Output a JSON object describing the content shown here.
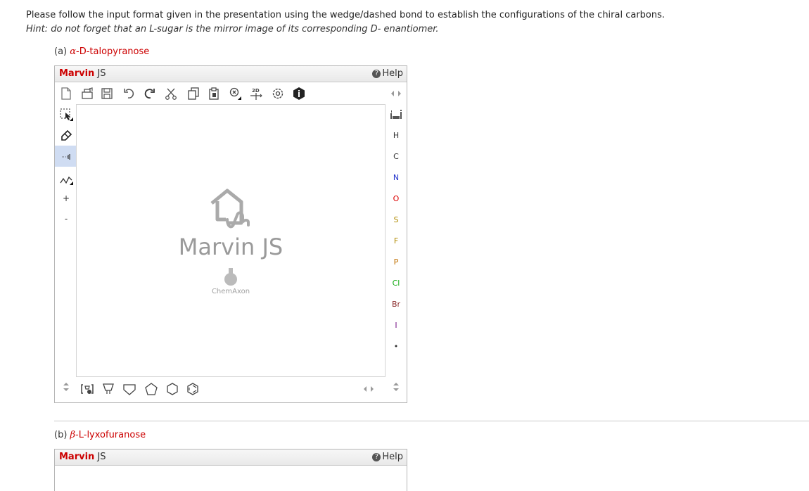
{
  "instructions": {
    "line1": "Please follow the input format given in the presentation using the wedge/dashed bond to establish the configurations of the chiral carbons.",
    "hint": "Hint: do not forget that an L-sugar is the mirror image of its corresponding D- enantiomer."
  },
  "question_a": {
    "prefix": "(a) ",
    "greek": "α",
    "name": "-D-talopyranose"
  },
  "question_b": {
    "prefix": "(b) ",
    "greek": "β",
    "name": "-L-lyxofuranose"
  },
  "editor": {
    "brand": "Marvin",
    "brand_suffix": " JS",
    "help_label": "Help",
    "help_icon": "?",
    "top_toolbar": [
      "new-document-icon",
      "open-icon",
      "save-icon",
      "undo-icon",
      "redo-icon",
      "cut-icon",
      "copy-icon",
      "paste-icon",
      "zoom-reset-icon",
      "clean-2d-icon",
      "settings-icon",
      "about-icon"
    ],
    "clean_label": "2D",
    "left_toolbar": [
      "select-icon",
      "erase-icon",
      "bond-icon",
      "chain-icon",
      "increase-charge",
      "decrease-charge"
    ],
    "charge_plus": "+",
    "charge_minus": "-",
    "logo_text": "Marvin JS",
    "logo_company": "ChemAxon",
    "elements": [
      {
        "symbol": "H",
        "color": "#333333"
      },
      {
        "symbol": "C",
        "color": "#333333"
      },
      {
        "symbol": "N",
        "color": "#2233cc"
      },
      {
        "symbol": "O",
        "color": "#dd0000"
      },
      {
        "symbol": "S",
        "color": "#b08a00"
      },
      {
        "symbol": "F",
        "color": "#b08a00"
      },
      {
        "symbol": "P",
        "color": "#c07000"
      },
      {
        "symbol": "Cl",
        "color": "#11aa11"
      },
      {
        "symbol": "Br",
        "color": "#8a2a2a"
      },
      {
        "symbol": "I",
        "color": "#7a1a8a"
      },
      {
        "symbol": "•",
        "color": "#333333"
      }
    ],
    "bottom_shapes": [
      "template-icon",
      "cyclopropane-icon",
      "cyclobutane-icon",
      "cyclopentane-icon",
      "cyclohexane-icon",
      "benzene-icon"
    ]
  }
}
